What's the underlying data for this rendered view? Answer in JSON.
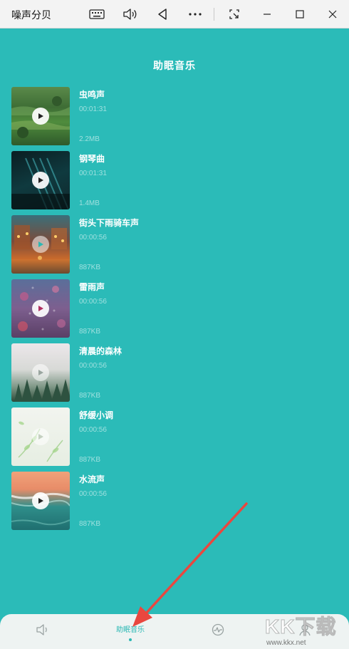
{
  "window": {
    "title": "噪声分贝",
    "controls": [
      "keyboard-icon",
      "volume-icon",
      "back-icon",
      "more-icon",
      "screenshot-icon",
      "minimize-icon",
      "maximize-icon",
      "close-icon"
    ]
  },
  "page": {
    "title": "助眠音乐"
  },
  "tracks": [
    {
      "name": "虫鸣声",
      "duration": "00:01:31",
      "size": "2.2MB"
    },
    {
      "name": "钢琴曲",
      "duration": "00:01:31",
      "size": "1.4MB"
    },
    {
      "name": "街头下雨骑车声",
      "duration": "00:00:56",
      "size": "887KB"
    },
    {
      "name": "雷雨声",
      "duration": "00:00:56",
      "size": "887KB"
    },
    {
      "name": "清晨的森林",
      "duration": "00:00:56",
      "size": "887KB"
    },
    {
      "name": "舒缓小调",
      "duration": "00:00:56",
      "size": "887KB"
    },
    {
      "name": "水流声",
      "duration": "00:00:56",
      "size": "887KB"
    }
  ],
  "bottom_nav": {
    "items": [
      {
        "icon": "speaker-icon",
        "label": ""
      },
      {
        "icon": "",
        "label": "助眠音乐",
        "active": true
      },
      {
        "icon": "waveform-icon",
        "label": ""
      },
      {
        "icon": "user-icon",
        "label": ""
      }
    ]
  },
  "watermark": {
    "brand": "KK下载",
    "url": "www.kkx.net"
  },
  "colors": {
    "background": "#2bbbb8",
    "accent": "#2bb8b4",
    "annotation": "#e9473f"
  }
}
